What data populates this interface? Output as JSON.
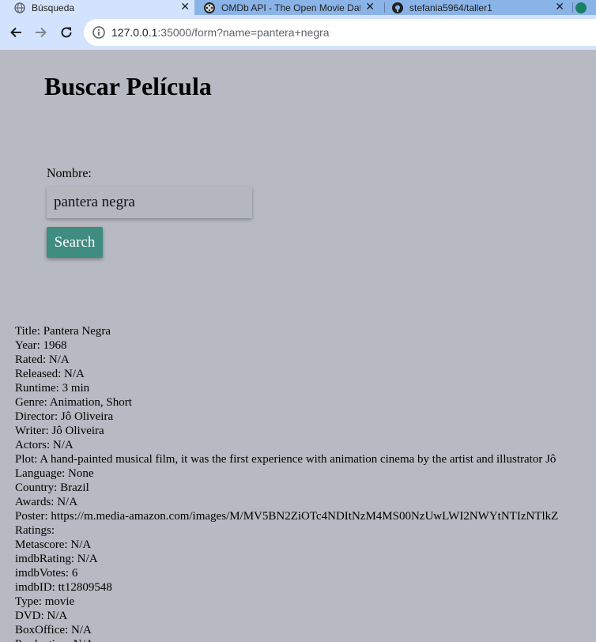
{
  "browser": {
    "tabs": [
      {
        "label": "Búsqueda",
        "icon": "globe-icon",
        "active": true
      },
      {
        "label": "OMDb API - The Open Movie Database",
        "icon": "film-reel-icon",
        "active": false
      },
      {
        "label": "stefania5964/taller1",
        "icon": "github-icon",
        "active": false
      },
      {
        "label": "",
        "icon": "chatgpt-icon",
        "active": false
      }
    ],
    "url_host": "127.0.0.1",
    "url_rest": ":35000/form?name=pantera+negra"
  },
  "page": {
    "title": "Buscar Película",
    "name_label": "Nombre:",
    "search_value": "pantera negra",
    "search_button": "Search"
  },
  "results": [
    "Title: Pantera Negra",
    "Year: 1968",
    "Rated: N/A",
    "Released: N/A",
    "Runtime: 3 min",
    "Genre: Animation, Short",
    "Director: Jô Oliveira",
    "Writer: Jô Oliveira",
    "Actors: N/A",
    "Plot: A hand-painted musical film, it was the first experience with animation cinema by the artist and illustrator Jô",
    "Language: None",
    "Country: Brazil",
    "Awards: N/A",
    "Poster: https://m.media-amazon.com/images/M/MV5BN2ZiOTc4NDItNzM4MS00NzUwLWI2NWYtNTIzNTlkZ",
    "Ratings:",
    "Metascore: N/A",
    "imdbRating: N/A",
    "imdbVotes: 6",
    "imdbID: tt12809548",
    "Type: movie",
    "DVD: N/A",
    "BoxOffice: N/A",
    "Production: N/A"
  ],
  "colors": {
    "page_bg": "#b7bac2",
    "button_bg": "#3f8c80",
    "tabbar_bg": "#8ab4e8",
    "toolbar_bg": "#d3e3fd"
  }
}
